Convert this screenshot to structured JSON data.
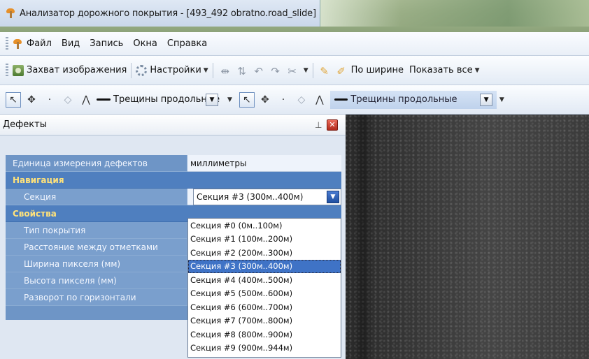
{
  "window": {
    "title": "Анализатор дорожного покрытия - [493_492 obratno.road_slide]"
  },
  "menu": [
    {
      "label": "Файл"
    },
    {
      "label": "Вид"
    },
    {
      "label": "Запись"
    },
    {
      "label": "Окна"
    },
    {
      "label": "Справка"
    }
  ],
  "toolbar1": {
    "capture_label": "Захват изображения",
    "settings_label": "Настройки",
    "fit_width_label": "По ширине",
    "show_all_label": "Показать все"
  },
  "toolbar2": {
    "left_combo_value": "Трещины продольные",
    "right_combo_value": "Трещины продольные"
  },
  "panel": {
    "title": "Дефекты",
    "units_key": "Единица измерения дефектов",
    "units_value": "миллиметры",
    "nav_category": "Навигация",
    "section_key": "Секция",
    "section_value": "Секция #3 (300м..400м)",
    "props_category": "Свойства",
    "props": [
      {
        "key": "Тип покрытия"
      },
      {
        "key": "Расстояние между отметками"
      },
      {
        "key": "Ширина пикселя (мм)"
      },
      {
        "key": "Высота пикселя (мм)"
      },
      {
        "key": "Разворот по горизонтали"
      }
    ],
    "dropdown_options": [
      "Секция #0 (0м..100м)",
      "Секция #1 (100м..200м)",
      "Секция #2 (200м..300м)",
      "Секция #3 (300м..400м)",
      "Секция #4 (400м..500м)",
      "Секция #5 (500м..600м)",
      "Секция #6 (600м..700м)",
      "Секция #7 (700м..800м)",
      "Секция #8 (800м..900м)",
      "Секция #9 (900м..944м)"
    ],
    "selected_index": 3
  }
}
